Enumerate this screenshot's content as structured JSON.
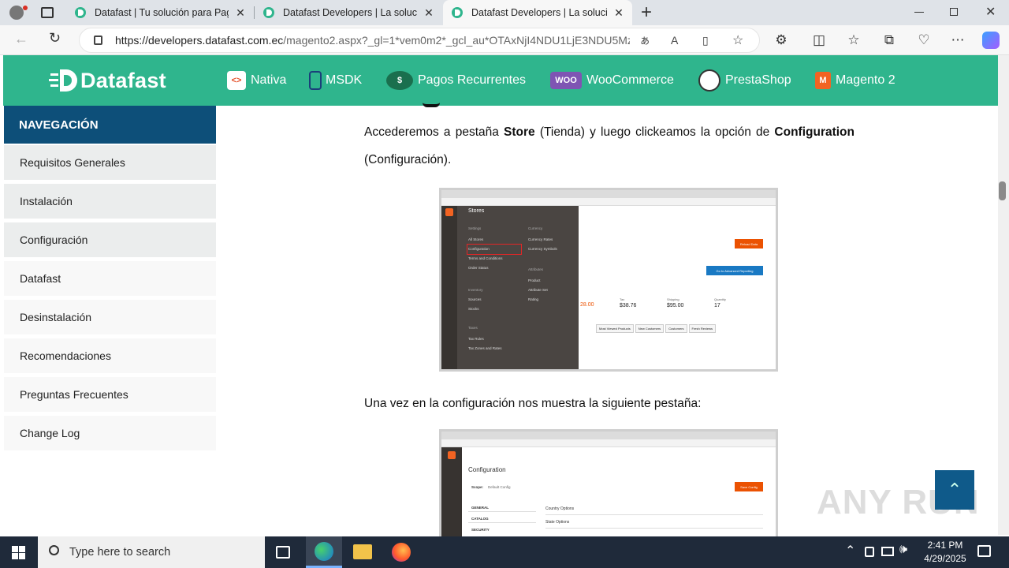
{
  "browser": {
    "tabs": [
      {
        "title": "Datafast | Tu solución para Pagos",
        "active": false
      },
      {
        "title": "Datafast Developers | La solución",
        "active": false
      },
      {
        "title": "Datafast Developers | La solución",
        "active": true
      }
    ],
    "url_host": "https://developers.datafast.com.ec",
    "url_path": "/magento2.aspx?_gl=1*vem0m2*_gcl_au*OTAxNjI4NDU1LjE3NDU5Mz...",
    "new_tab": "+"
  },
  "site": {
    "logo": "Datafast",
    "nav": [
      {
        "label": "Nativa",
        "icon": "html-icon"
      },
      {
        "label": "MSDK",
        "icon": "mobile-sdk-icon"
      },
      {
        "label": "Pagos Recurrentes",
        "icon": "money-icon"
      },
      {
        "label": "WooCommerce",
        "icon": "woocommerce-icon",
        "badge": "WOO"
      },
      {
        "label": "PrestaShop",
        "icon": "prestashop-icon"
      },
      {
        "label": "Magento 2",
        "icon": "magento-icon"
      }
    ],
    "accent": "#2fb58d",
    "sidebar_color": "#0d4f79"
  },
  "sidebar": {
    "heading": "NAVEGACIÓN",
    "items": [
      "Requisitos Generales",
      "Instalación",
      "Configuración",
      "Datafast",
      "Desinstalación",
      "Recomendaciones",
      "Preguntas Frecuentes",
      "Change Log"
    ]
  },
  "content": {
    "p1_a": "Accederemos a pestaña ",
    "p1_store": "Store",
    "p1_b": " (Tienda) y luego clickeamos la opción de ",
    "p1_config": "Configuration",
    "p1_c": " (Configuración).",
    "p2": "Una vez en la configuración nos muestra la siguiente pestaña:",
    "shot1": {
      "panel_title": "Stores",
      "settings": "Settings",
      "all_stores": "All Stores",
      "configuration": "Configuration",
      "terms": "Terms and Conditions",
      "order_status": "Order Status",
      "inventory": "Inventory",
      "sources": "Sources",
      "stocks": "Stocks",
      "taxes": "Taxes",
      "tax_rules": "Tax Rules",
      "tax_zones": "Tax Zones and Rates",
      "currency": "Currency",
      "currency_rates": "Currency Rates",
      "currency_symbols": "Currency Symbols",
      "attributes": "Attributes",
      "product": "Product",
      "attribute_set": "Attribute Set",
      "rating": "Rating",
      "reload": "Reload Data",
      "advanced": "Go to Advanced Reporting",
      "tax_label": "Tax",
      "tax_value": "$38.76",
      "shipping_label": "Shipping",
      "shipping_value": "$95.00",
      "quantity_label": "Quantity",
      "quantity_value": "17",
      "revenue_value": "28.00",
      "tabs": [
        "Most Viewed Products",
        "New Customers",
        "Customers",
        "Fresh Reviews"
      ]
    },
    "shot2": {
      "title": "Configuration",
      "scope": "Scope:",
      "scope_value": "Default Config",
      "save": "Save Config",
      "general": "GENERAL",
      "catalog": "CATALOG",
      "security": "SECURITY",
      "country_options": "Country Options",
      "state_options": "State Options"
    }
  },
  "watermark": "ANY RUN",
  "taskbar": {
    "search_placeholder": "Type here to search",
    "time": "2:41 PM",
    "date": "4/29/2025"
  }
}
